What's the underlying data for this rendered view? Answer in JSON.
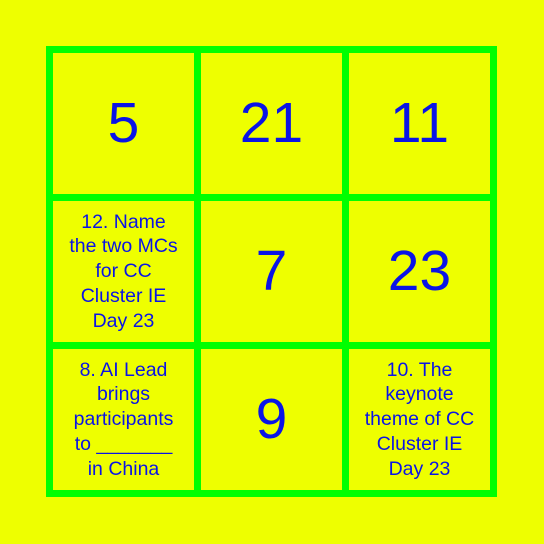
{
  "board": {
    "colors": {
      "background": "#eeff00",
      "grid": "#00ff00",
      "text": "#0a14e6"
    },
    "cells": [
      {
        "type": "number",
        "text": "5"
      },
      {
        "type": "number",
        "text": "21"
      },
      {
        "type": "number",
        "text": "11"
      },
      {
        "type": "text",
        "text": "12. Name\nthe two MCs\nfor CC\nCluster IE\nDay 23"
      },
      {
        "type": "number",
        "text": "7"
      },
      {
        "type": "number",
        "text": "23"
      },
      {
        "type": "text",
        "text": "8. AI Lead\nbrings\nparticipants\nto _______\nin China"
      },
      {
        "type": "number",
        "text": "9"
      },
      {
        "type": "text",
        "text": "10. The\nkeynote\ntheme of CC\nCluster IE\nDay 23"
      }
    ]
  }
}
